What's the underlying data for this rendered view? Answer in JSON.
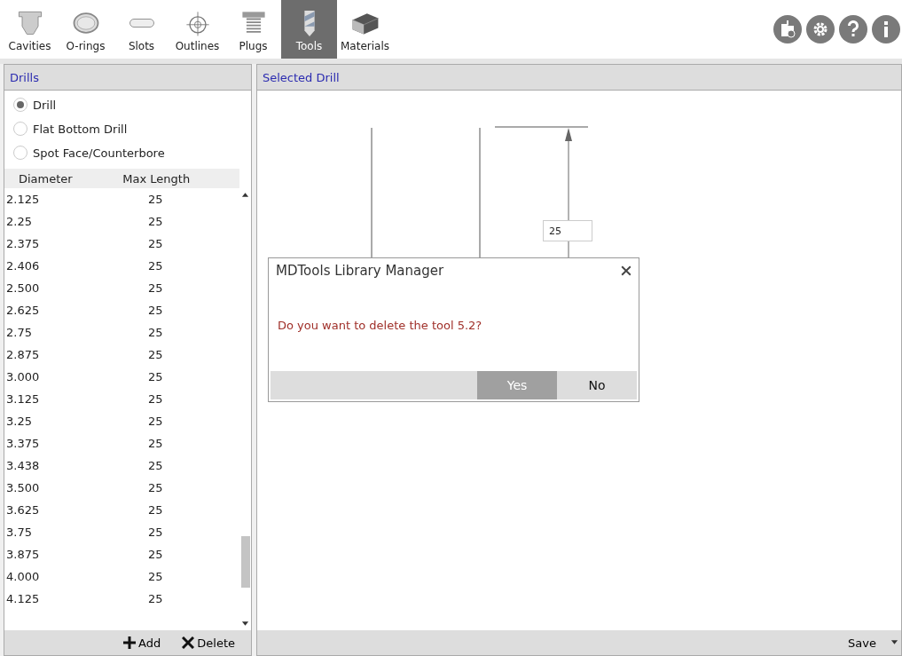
{
  "toolbar": {
    "tabs": [
      {
        "label": "Cavities",
        "kind": "cavity",
        "selected": false
      },
      {
        "label": "O-rings",
        "kind": "oring",
        "selected": false
      },
      {
        "label": "Slots",
        "kind": "slot",
        "selected": false
      },
      {
        "label": "Outlines",
        "kind": "outline",
        "selected": false
      },
      {
        "label": "Plugs",
        "kind": "plug",
        "selected": false
      },
      {
        "label": "Tools",
        "kind": "tool",
        "selected": true
      },
      {
        "label": "Materials",
        "kind": "material",
        "selected": false
      }
    ],
    "actions": [
      {
        "kind": "import"
      },
      {
        "kind": "settings"
      },
      {
        "kind": "help"
      },
      {
        "kind": "info"
      }
    ]
  },
  "drills_panel": {
    "title": "Drills",
    "types": [
      {
        "label": "Drill",
        "selected": true
      },
      {
        "label": "Flat Bottom Drill",
        "selected": false
      },
      {
        "label": "Spot Face/Counterbore",
        "selected": false
      }
    ],
    "table": {
      "columns": [
        "Diameter",
        "Max Length"
      ],
      "rows": [
        [
          "2.125",
          "25"
        ],
        [
          "2.25",
          "25"
        ],
        [
          "2.375",
          "25"
        ],
        [
          "2.406",
          "25"
        ],
        [
          "2.500",
          "25"
        ],
        [
          "2.625",
          "25"
        ],
        [
          "2.75",
          "25"
        ],
        [
          "2.875",
          "25"
        ],
        [
          "3.000",
          "25"
        ],
        [
          "3.125",
          "25"
        ],
        [
          "3.25",
          "25"
        ],
        [
          "3.375",
          "25"
        ],
        [
          "3.438",
          "25"
        ],
        [
          "3.500",
          "25"
        ],
        [
          "3.625",
          "25"
        ],
        [
          "3.75",
          "25"
        ],
        [
          "3.875",
          "25"
        ],
        [
          "4.000",
          "25"
        ],
        [
          "4.125",
          "25"
        ]
      ]
    },
    "buttons": [
      {
        "label": "Add",
        "kind": "add"
      },
      {
        "label": "Delete",
        "kind": "delete"
      }
    ]
  },
  "selected_panel": {
    "title": "Selected Drill",
    "dimension": "25",
    "save_button": "Save"
  },
  "dialog": {
    "title": "MDTools Library Manager",
    "message": "Do you want to delete the tool 5.2?",
    "buttons": [
      {
        "label": "Yes",
        "selected": true
      },
      {
        "label": "No",
        "selected": false
      }
    ]
  }
}
